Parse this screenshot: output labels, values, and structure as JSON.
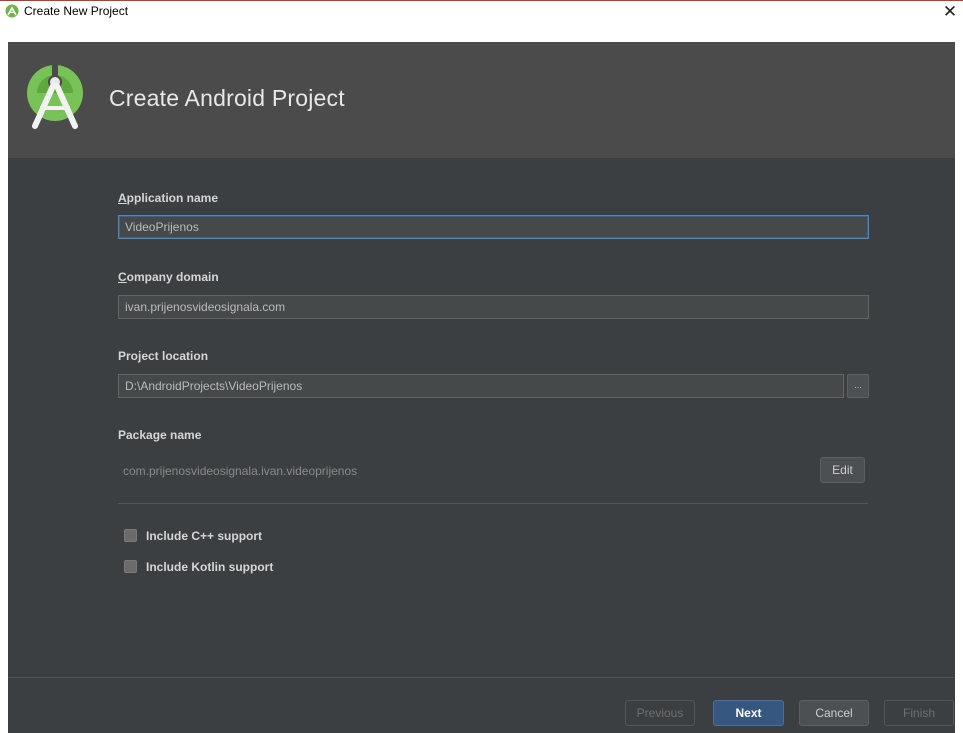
{
  "window": {
    "title": "Create New Project",
    "close_symbol": "✕"
  },
  "header": {
    "heading": "Create Android Project",
    "logo_icon": "android-studio-icon"
  },
  "form": {
    "application_name": {
      "label_mnemonic": "A",
      "label_rest": "pplication name",
      "value": "VideoPrijenos"
    },
    "company_domain": {
      "label_mnemonic": "C",
      "label_rest": "ompany domain",
      "value": "ivan.prijenosvideosignala.com"
    },
    "project_location": {
      "label": "Project location",
      "value": "D:\\AndroidProjects\\VideoPrijenos",
      "browse_label": "..."
    },
    "package_name": {
      "label": "Package name",
      "value": "com.prijenosvideosignala.ivan.videoprijenos",
      "edit_label": "Edit"
    },
    "options": [
      {
        "label": "Include C++ support",
        "checked": false
      },
      {
        "label": "Include Kotlin support",
        "checked": false
      }
    ]
  },
  "footer": {
    "previous_label": "Previous",
    "next_label": "Next",
    "cancel_label": "Cancel",
    "finish_label": "Finish"
  },
  "colors": {
    "header_bg": "#4b4b4b",
    "content_bg": "#3c3f41",
    "focus_border": "#4a88c7",
    "primary_button": "#365880"
  }
}
